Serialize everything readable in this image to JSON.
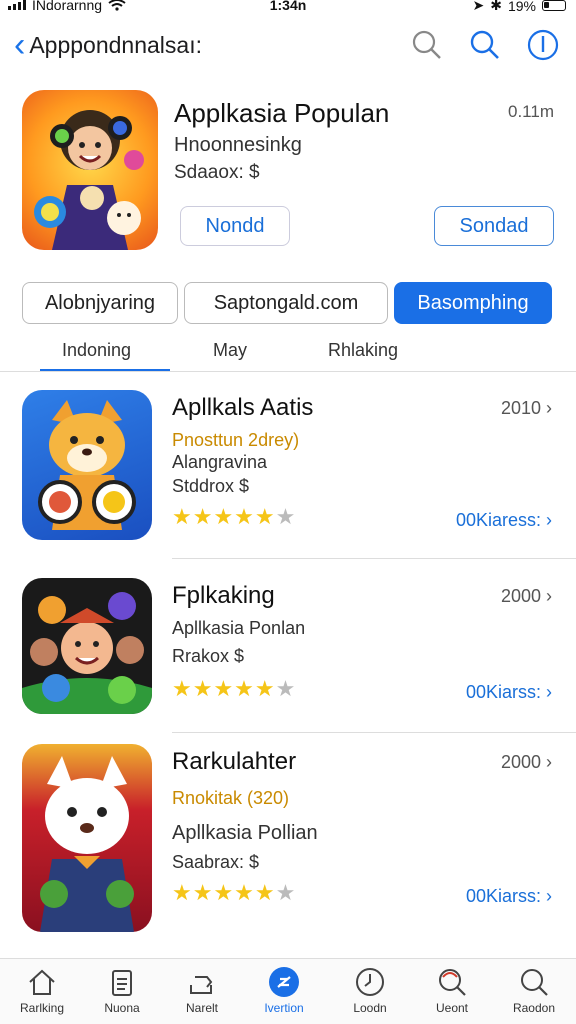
{
  "status": {
    "carrier": "INdorarnng",
    "time": "1:34n",
    "battery": "19%"
  },
  "nav": {
    "back_label": "Apppondnnalsaı:"
  },
  "featured": {
    "title": "Applkasia Populan",
    "meta": "0.11m",
    "subtitle": "Hnoonnesinkg",
    "line2": "Sdaaox: $",
    "button1": "Nondd",
    "button2": "Sondad"
  },
  "filters": [
    "Alobnjyaring",
    "Saptongald.com",
    "Basomphing"
  ],
  "tabs": [
    "Indoning",
    "May",
    "Rhlaking"
  ],
  "apps": [
    {
      "name": "Apllkals Aatis",
      "year": "2010",
      "line1": "Pnosttun 2drey)",
      "line2": "Alangravina",
      "line3": "Stddrox $",
      "stars": 4,
      "more": "00Kiaress:",
      "line1_color": "#c98a00"
    },
    {
      "name": "Fplkaking",
      "year": "2000",
      "line1": "Apllkasia Ponlan",
      "line2": "Rrakox $",
      "line3": "",
      "stars": 4,
      "more": "00Kiarss:",
      "line1_color": "#333333"
    },
    {
      "name": "Rarkulahter",
      "year": "2000",
      "line1": "Rnokitak (320)",
      "line2": "Apllkasia Pollian",
      "line3": "Saabrax: $",
      "stars": 4,
      "more": "00Kiarss:",
      "line1_color": "#c98a00"
    }
  ],
  "tabbar": [
    "Rarlking",
    "Nuona",
    "Narelt",
    "Ivertion",
    "Loodn",
    "Ueont",
    "Raodon"
  ],
  "colors": {
    "accent": "#1a6fe6",
    "star": "#f5c518"
  }
}
